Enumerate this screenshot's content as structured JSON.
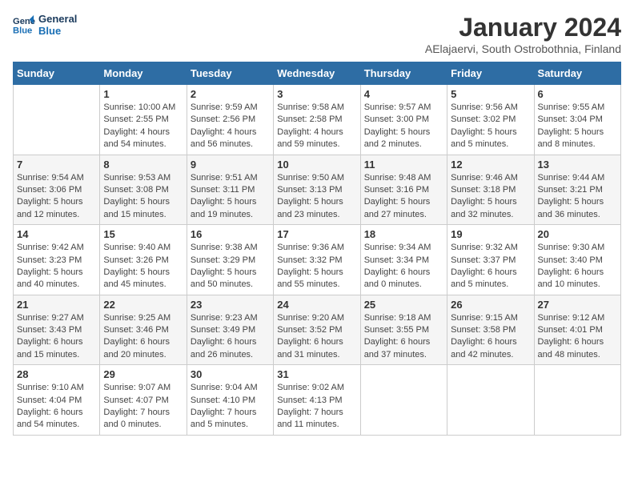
{
  "header": {
    "logo_line1": "General",
    "logo_line2": "Blue",
    "title": "January 2024",
    "subtitle": "AElajaervi, South Ostrobothnia, Finland"
  },
  "weekdays": [
    "Sunday",
    "Monday",
    "Tuesday",
    "Wednesday",
    "Thursday",
    "Friday",
    "Saturday"
  ],
  "weeks": [
    [
      {
        "day": "",
        "info": ""
      },
      {
        "day": "1",
        "info": "Sunrise: 10:00 AM\nSunset: 2:55 PM\nDaylight: 4 hours\nand 54 minutes."
      },
      {
        "day": "2",
        "info": "Sunrise: 9:59 AM\nSunset: 2:56 PM\nDaylight: 4 hours\nand 56 minutes."
      },
      {
        "day": "3",
        "info": "Sunrise: 9:58 AM\nSunset: 2:58 PM\nDaylight: 4 hours\nand 59 minutes."
      },
      {
        "day": "4",
        "info": "Sunrise: 9:57 AM\nSunset: 3:00 PM\nDaylight: 5 hours\nand 2 minutes."
      },
      {
        "day": "5",
        "info": "Sunrise: 9:56 AM\nSunset: 3:02 PM\nDaylight: 5 hours\nand 5 minutes."
      },
      {
        "day": "6",
        "info": "Sunrise: 9:55 AM\nSunset: 3:04 PM\nDaylight: 5 hours\nand 8 minutes."
      }
    ],
    [
      {
        "day": "7",
        "info": "Sunrise: 9:54 AM\nSunset: 3:06 PM\nDaylight: 5 hours\nand 12 minutes."
      },
      {
        "day": "8",
        "info": "Sunrise: 9:53 AM\nSunset: 3:08 PM\nDaylight: 5 hours\nand 15 minutes."
      },
      {
        "day": "9",
        "info": "Sunrise: 9:51 AM\nSunset: 3:11 PM\nDaylight: 5 hours\nand 19 minutes."
      },
      {
        "day": "10",
        "info": "Sunrise: 9:50 AM\nSunset: 3:13 PM\nDaylight: 5 hours\nand 23 minutes."
      },
      {
        "day": "11",
        "info": "Sunrise: 9:48 AM\nSunset: 3:16 PM\nDaylight: 5 hours\nand 27 minutes."
      },
      {
        "day": "12",
        "info": "Sunrise: 9:46 AM\nSunset: 3:18 PM\nDaylight: 5 hours\nand 32 minutes."
      },
      {
        "day": "13",
        "info": "Sunrise: 9:44 AM\nSunset: 3:21 PM\nDaylight: 5 hours\nand 36 minutes."
      }
    ],
    [
      {
        "day": "14",
        "info": "Sunrise: 9:42 AM\nSunset: 3:23 PM\nDaylight: 5 hours\nand 40 minutes."
      },
      {
        "day": "15",
        "info": "Sunrise: 9:40 AM\nSunset: 3:26 PM\nDaylight: 5 hours\nand 45 minutes."
      },
      {
        "day": "16",
        "info": "Sunrise: 9:38 AM\nSunset: 3:29 PM\nDaylight: 5 hours\nand 50 minutes."
      },
      {
        "day": "17",
        "info": "Sunrise: 9:36 AM\nSunset: 3:32 PM\nDaylight: 5 hours\nand 55 minutes."
      },
      {
        "day": "18",
        "info": "Sunrise: 9:34 AM\nSunset: 3:34 PM\nDaylight: 6 hours\nand 0 minutes."
      },
      {
        "day": "19",
        "info": "Sunrise: 9:32 AM\nSunset: 3:37 PM\nDaylight: 6 hours\nand 5 minutes."
      },
      {
        "day": "20",
        "info": "Sunrise: 9:30 AM\nSunset: 3:40 PM\nDaylight: 6 hours\nand 10 minutes."
      }
    ],
    [
      {
        "day": "21",
        "info": "Sunrise: 9:27 AM\nSunset: 3:43 PM\nDaylight: 6 hours\nand 15 minutes."
      },
      {
        "day": "22",
        "info": "Sunrise: 9:25 AM\nSunset: 3:46 PM\nDaylight: 6 hours\nand 20 minutes."
      },
      {
        "day": "23",
        "info": "Sunrise: 9:23 AM\nSunset: 3:49 PM\nDaylight: 6 hours\nand 26 minutes."
      },
      {
        "day": "24",
        "info": "Sunrise: 9:20 AM\nSunset: 3:52 PM\nDaylight: 6 hours\nand 31 minutes."
      },
      {
        "day": "25",
        "info": "Sunrise: 9:18 AM\nSunset: 3:55 PM\nDaylight: 6 hours\nand 37 minutes."
      },
      {
        "day": "26",
        "info": "Sunrise: 9:15 AM\nSunset: 3:58 PM\nDaylight: 6 hours\nand 42 minutes."
      },
      {
        "day": "27",
        "info": "Sunrise: 9:12 AM\nSunset: 4:01 PM\nDaylight: 6 hours\nand 48 minutes."
      }
    ],
    [
      {
        "day": "28",
        "info": "Sunrise: 9:10 AM\nSunset: 4:04 PM\nDaylight: 6 hours\nand 54 minutes."
      },
      {
        "day": "29",
        "info": "Sunrise: 9:07 AM\nSunset: 4:07 PM\nDaylight: 7 hours\nand 0 minutes."
      },
      {
        "day": "30",
        "info": "Sunrise: 9:04 AM\nSunset: 4:10 PM\nDaylight: 7 hours\nand 5 minutes."
      },
      {
        "day": "31",
        "info": "Sunrise: 9:02 AM\nSunset: 4:13 PM\nDaylight: 7 hours\nand 11 minutes."
      },
      {
        "day": "",
        "info": ""
      },
      {
        "day": "",
        "info": ""
      },
      {
        "day": "",
        "info": ""
      }
    ]
  ]
}
